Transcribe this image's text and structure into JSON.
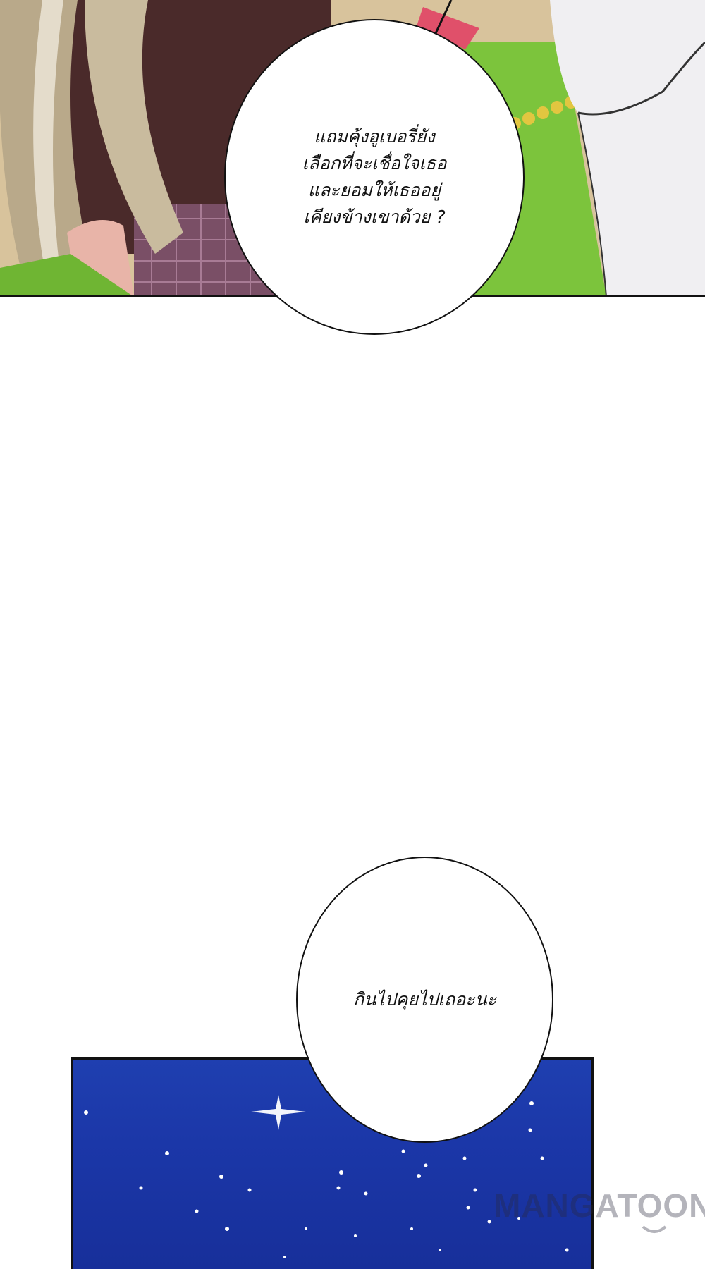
{
  "panels": {
    "top_scene": {
      "description_id": "panel-top"
    },
    "sky_scene": {
      "description_id": "panel-sky"
    }
  },
  "bubbles": [
    {
      "lines": [
        "แถมคุ้งอูเบอรี่ยัง",
        "เลือกที่จะเชื่อใจเธอ",
        "และยอมให้เธออยู่",
        "เคียงข้างเขาด้วย ?"
      ]
    },
    {
      "lines": [
        "กินไปคุยไปเถอะนะ"
      ]
    }
  ],
  "watermark": {
    "text": "MANGATOON"
  },
  "colors": {
    "sky": "#1b37a8",
    "outline": "#111111",
    "grass": "#7cc43c"
  }
}
